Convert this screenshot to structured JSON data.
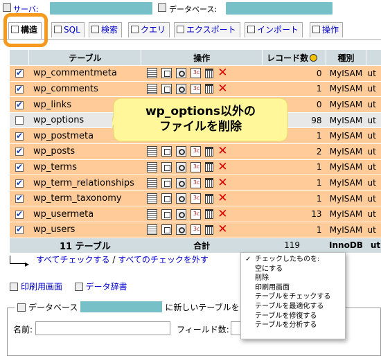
{
  "topbar": {
    "server_label": "サーバ:",
    "database_label": "データベース:"
  },
  "tabs": [
    {
      "label": "構造",
      "icon": "structure-icon",
      "active": true
    },
    {
      "label": "SQL",
      "icon": "sql-icon"
    },
    {
      "label": "検索",
      "icon": "search-icon"
    },
    {
      "label": "クエリ",
      "icon": "query-icon"
    },
    {
      "label": "エクスポート",
      "icon": "export-icon"
    },
    {
      "label": "インポート",
      "icon": "import-icon"
    },
    {
      "label": "操作",
      "icon": "operations-icon"
    }
  ],
  "table": {
    "headers": {
      "table": "テーブル",
      "operations": "操作",
      "records": "レコード数",
      "type": "種別"
    },
    "rows": [
      {
        "name": "wp_commentmeta",
        "checked": true,
        "records": "0",
        "engine": "MyISAM",
        "collation": "ut"
      },
      {
        "name": "wp_comments",
        "checked": true,
        "records": "1",
        "engine": "MyISAM",
        "collation": "ut"
      },
      {
        "name": "wp_links",
        "checked": true,
        "records": "0",
        "engine": "MyISAM",
        "collation": "ut"
      },
      {
        "name": "wp_options",
        "checked": false,
        "records": "98",
        "engine": "MyISAM",
        "collation": "ut"
      },
      {
        "name": "wp_postmeta",
        "checked": true,
        "records": "1",
        "engine": "MyISAM",
        "collation": "ut"
      },
      {
        "name": "wp_posts",
        "checked": true,
        "records": "2",
        "engine": "MyISAM",
        "collation": "ut"
      },
      {
        "name": "wp_terms",
        "checked": true,
        "records": "1",
        "engine": "MyISAM",
        "collation": "ut"
      },
      {
        "name": "wp_term_relationships",
        "checked": true,
        "records": "1",
        "engine": "MyISAM",
        "collation": "ut"
      },
      {
        "name": "wp_term_taxonomy",
        "checked": true,
        "records": "1",
        "engine": "MyISAM",
        "collation": "ut"
      },
      {
        "name": "wp_usermeta",
        "checked": true,
        "records": "13",
        "engine": "MyISAM",
        "collation": "ut"
      },
      {
        "name": "wp_users",
        "checked": true,
        "records": "1",
        "engine": "MyISAM",
        "collation": "ut"
      }
    ],
    "footer": {
      "count": "11 テーブル",
      "total_label": "合計",
      "records": "119",
      "engine": "InnoDB",
      "collation": "ut"
    }
  },
  "callout": {
    "line1": "wp_options以外の",
    "line2": "ファイルを削除",
    "color": "#fff79a"
  },
  "check": {
    "check_all": "すべてチェックする",
    "separator": "/",
    "uncheck_all": "すべてのチェックを外す"
  },
  "dropdown": {
    "items": [
      "チェックしたものを:",
      "空にする",
      "削除",
      "印刷用画面",
      "テーブルをチェックする",
      "テーブルを最適化する",
      "テーブルを修復する",
      "テーブルを分析する"
    ]
  },
  "links": {
    "print_view": "印刷用画面",
    "data_dictionary": "データ辞書"
  },
  "newtable": {
    "legend_prefix": "データベース",
    "legend_suffix": "に新しいテーブルを",
    "name_label": "名前:",
    "fields_label": "フィールド数:"
  },
  "colors": {
    "row_checked": "#ffcc99",
    "row_unchecked": "#e8e8e8",
    "header": "#d0dce0",
    "highlight": "#f59a1d",
    "drop": "#e00000"
  }
}
